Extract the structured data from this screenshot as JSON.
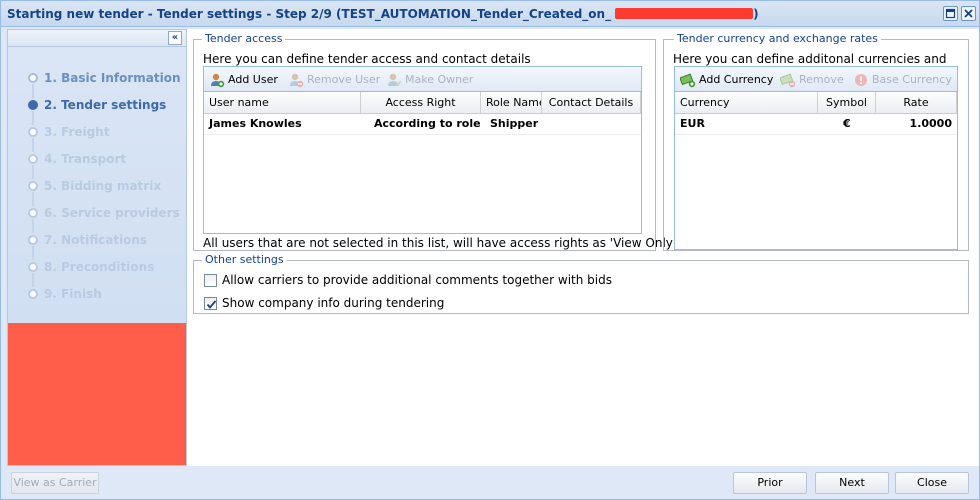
{
  "window": {
    "title": "Starting new tender - Tender settings - Step 2/9 (TEST_AUTOMATION_Tender_Created_on_",
    "maximize_label": "□",
    "close_label": "✕"
  },
  "sidebar": {
    "collapse_label": "«",
    "steps": [
      {
        "label": "1. Basic Information",
        "state": "done"
      },
      {
        "label": "2. Tender settings",
        "state": "current"
      },
      {
        "label": "3. Freight",
        "state": "pending"
      },
      {
        "label": "4. Transport",
        "state": "pending"
      },
      {
        "label": "5. Bidding matrix",
        "state": "pending"
      },
      {
        "label": "6. Service providers",
        "state": "pending"
      },
      {
        "label": "7. Notifications",
        "state": "pending"
      },
      {
        "label": "8. Preconditions",
        "state": "pending"
      },
      {
        "label": "9. Finish",
        "state": "pending"
      }
    ]
  },
  "tender_access": {
    "legend": "Tender access",
    "description": "Here you can define tender access and contact details",
    "toolbar": {
      "add_user": "Add User",
      "remove_user": "Remove User",
      "make_owner": "Make Owner"
    },
    "columns": [
      "User name",
      "Access Right",
      "Role Name",
      "Contact Details"
    ],
    "rows": [
      {
        "user_name": "James Knowles",
        "access_right": "According to role",
        "role_name": "Shipper",
        "contact_details": ""
      }
    ],
    "note": "All users that are not selected in this list, will have access rights as 'View Only'"
  },
  "currency": {
    "legend": "Tender currency and exchange rates",
    "description": "Here you can define additonal currencies and",
    "toolbar": {
      "add_currency": "Add Currency",
      "remove": "Remove",
      "base_currency": "Base Currency"
    },
    "columns": [
      "Currency",
      "Symbol",
      "Rate"
    ],
    "rows": [
      {
        "currency": "EUR",
        "symbol": "€",
        "rate": "1.0000"
      }
    ]
  },
  "other_settings": {
    "legend": "Other settings",
    "options": [
      {
        "label": "Allow carriers to provide additional comments together with bids",
        "checked": false
      },
      {
        "label": "Show company info during tendering",
        "checked": true
      }
    ]
  },
  "footer": {
    "view_as_carrier": "View as Carrier",
    "prior": "Prior",
    "next": "Next",
    "close": "Close"
  }
}
